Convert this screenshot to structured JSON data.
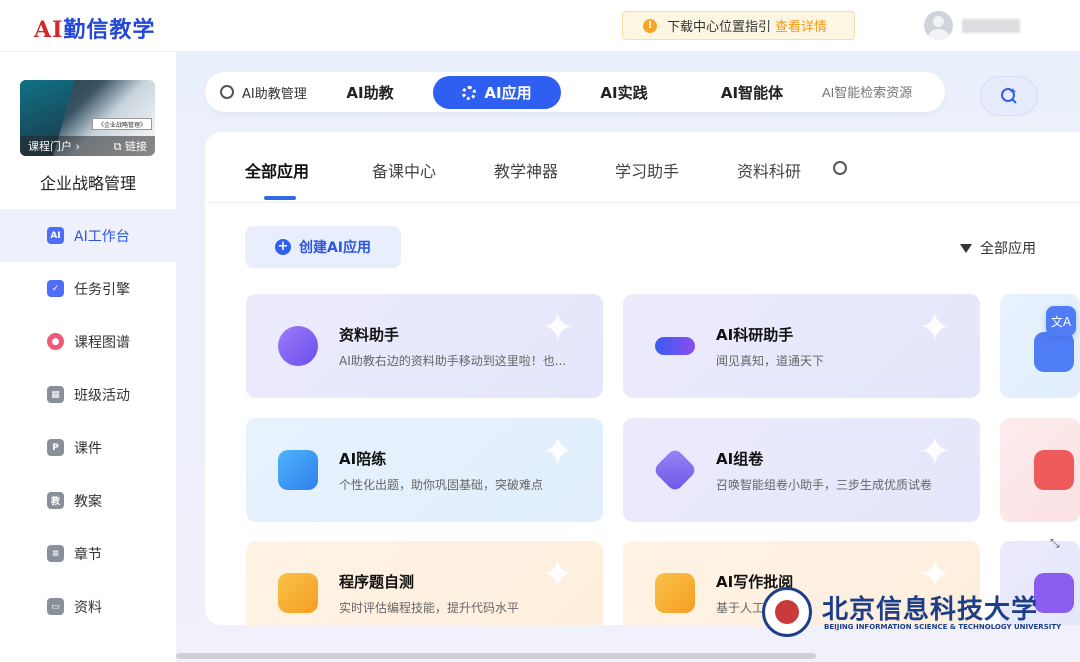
{
  "header": {
    "logo": "AI勤信教学",
    "notice_text": "下载中心位置指引",
    "notice_link": "查看详情"
  },
  "sidebar": {
    "portal_label": "课程门户",
    "link_label": "链接",
    "cover_title": "《企业战略管理》",
    "course_name": "企业战略管理",
    "items": [
      {
        "label": "AI工作台",
        "icon": "ai-workbench-icon",
        "color": "#4f6ef7"
      },
      {
        "label": "任务引擎",
        "icon": "task-icon",
        "color": "#4f6ef7"
      },
      {
        "label": "课程图谱",
        "icon": "graph-icon",
        "color": "#ef5a7a"
      },
      {
        "label": "班级活动",
        "icon": "grid-icon",
        "color": "#8a9099"
      },
      {
        "label": "课件",
        "icon": "courseware-icon",
        "color": "#8a9099"
      },
      {
        "label": "教案",
        "icon": "lesson-plan-icon",
        "color": "#8a9099"
      },
      {
        "label": "章节",
        "icon": "chapter-icon",
        "color": "#8a9099"
      },
      {
        "label": "资料",
        "icon": "folder-icon",
        "color": "#8a9099"
      }
    ]
  },
  "topnav": {
    "manage_label": "AI助教管理",
    "tabs": [
      "AI助教",
      "AI应用",
      "AI实践",
      "AI智能体"
    ],
    "active_tab": "AI应用",
    "search_placeholder": "AI智能检索资源"
  },
  "subtabs": {
    "items": [
      "全部应用",
      "备课中心",
      "教学神器",
      "学习助手",
      "资料科研"
    ],
    "active": "全部应用"
  },
  "actions": {
    "create_label": "创建AI应用",
    "filter_label": "全部应用"
  },
  "cards": [
    {
      "title": "资料助手",
      "desc": "AI助教右边的资料助手移动到这里啦！也...",
      "theme": "purple"
    },
    {
      "title": "AI科研助手",
      "desc": "闻见真知，道通天下",
      "theme": "purple"
    },
    {
      "title": "AI陪练",
      "desc": "个性化出题，助你巩固基础，突破难点",
      "theme": "blue"
    },
    {
      "title": "AI组卷",
      "desc": "召唤智能组卷小助手，三步生成优质试卷",
      "theme": "purple"
    },
    {
      "title": "程序题自测",
      "desc": "实时评估编程技能，提升代码水平",
      "theme": "orange"
    },
    {
      "title": "AI写作批阅",
      "desc": "基于人工",
      "theme": "orange"
    }
  ],
  "watermark": {
    "cn": "北京信息科技大学",
    "en": "BEIJING INFORMATION SCIENCE & TECHNOLOGY UNIVERSITY"
  },
  "colors": {
    "primary": "#2f5ff0",
    "notice": "#f29a10"
  }
}
